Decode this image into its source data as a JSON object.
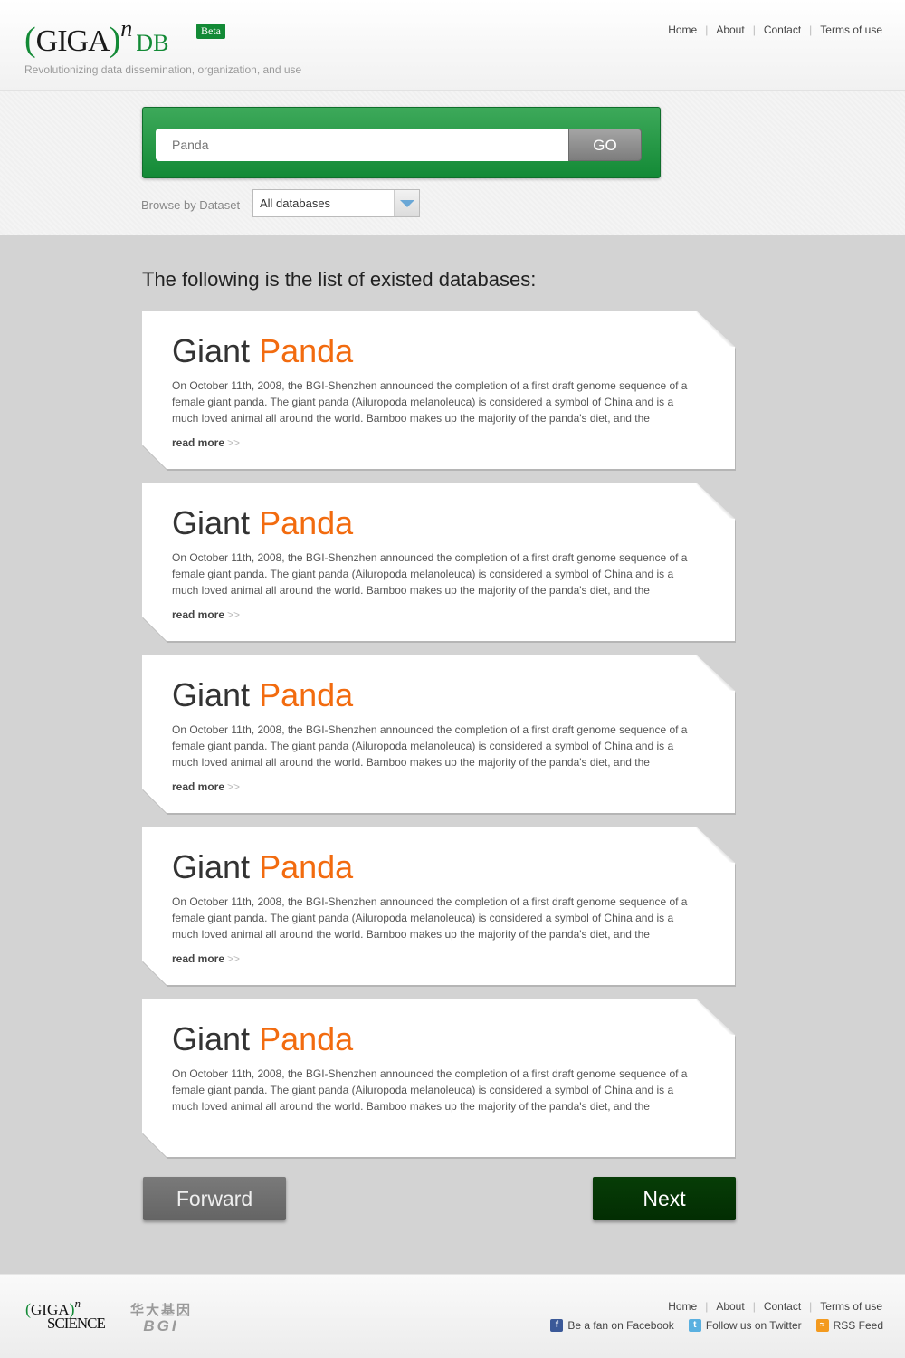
{
  "header": {
    "logo": {
      "paren": "(",
      "giga": "GIGA",
      "paren_close": ")",
      "sup": "n",
      "db": "DB"
    },
    "beta": "Beta",
    "tagline": "Revolutionizing data dissemination, organization, and use",
    "nav": [
      "Home",
      "About",
      "Contact",
      "Terms of use"
    ]
  },
  "search": {
    "placeholder": "Panda",
    "go_label": "GO",
    "browse_label": "Browse by Dataset",
    "select_value": "All databases"
  },
  "list": {
    "title": "The following is the list of existed databases:",
    "items": [
      {
        "title_a": "Giant",
        "title_b": "Panda",
        "text": "On October 11th, 2008, the BGI-Shenzhen announced the completion of a first draft genome sequence of a female giant panda. The giant panda (Ailuropoda melanoleuca) is considered a symbol of China and is a much loved animal all around the world. Bamboo makes up the majority of the panda's diet, and the",
        "read_more": "read more"
      },
      {
        "title_a": "Giant",
        "title_b": "Panda",
        "text": "On October 11th, 2008, the BGI-Shenzhen announced the completion of a first draft genome sequence of a female giant panda. The giant panda (Ailuropoda melanoleuca) is considered a symbol of China and is a much loved animal all around the world. Bamboo makes up the majority of the panda's diet, and the",
        "read_more": "read more"
      },
      {
        "title_a": "Giant",
        "title_b": "Panda",
        "text": "On October 11th, 2008, the BGI-Shenzhen announced the completion of a first draft genome sequence of a female giant panda. The giant panda (Ailuropoda melanoleuca) is considered a symbol of China and is a much loved animal all around the world. Bamboo makes up the majority of the panda's diet, and the",
        "read_more": "read more"
      },
      {
        "title_a": "Giant",
        "title_b": "Panda",
        "text": "On October 11th, 2008, the BGI-Shenzhen announced the completion of a first draft genome sequence of a female giant panda. The giant panda (Ailuropoda melanoleuca) is considered a symbol of China and is a much loved animal all around the world. Bamboo makes up the majority of the panda's diet, and the",
        "read_more": "read more"
      },
      {
        "title_a": "Giant",
        "title_b": "Panda",
        "text": "On October 11th, 2008, the BGI-Shenzhen announced the completion of a first draft genome sequence of a female giant panda. The giant panda (Ailuropoda melanoleuca) is considered a symbol of China and is a much loved animal all around the world. Bamboo makes up the majority of the panda's diet, and the",
        "read_more": ""
      }
    ]
  },
  "pager": {
    "forward": "Forward",
    "next": "Next"
  },
  "footer": {
    "logo": {
      "paren": "(",
      "giga": "GIGA",
      "paren_close": ")",
      "sup": "n",
      "science": "SCIENCE"
    },
    "bgi_cn": "华大基因",
    "bgi_en": "BGI",
    "nav": [
      "Home",
      "About",
      "Contact",
      "Terms of use"
    ],
    "social": [
      {
        "icon": "facebook-icon",
        "label": "Be a fan on Facebook"
      },
      {
        "icon": "twitter-icon",
        "label": "Follow us on Twitter"
      },
      {
        "icon": "rss-icon",
        "label": "RSS Feed"
      }
    ]
  },
  "colors": {
    "brand_green": "#138a36",
    "highlight_orange": "#f26b0f",
    "next_button": "#022d02"
  }
}
